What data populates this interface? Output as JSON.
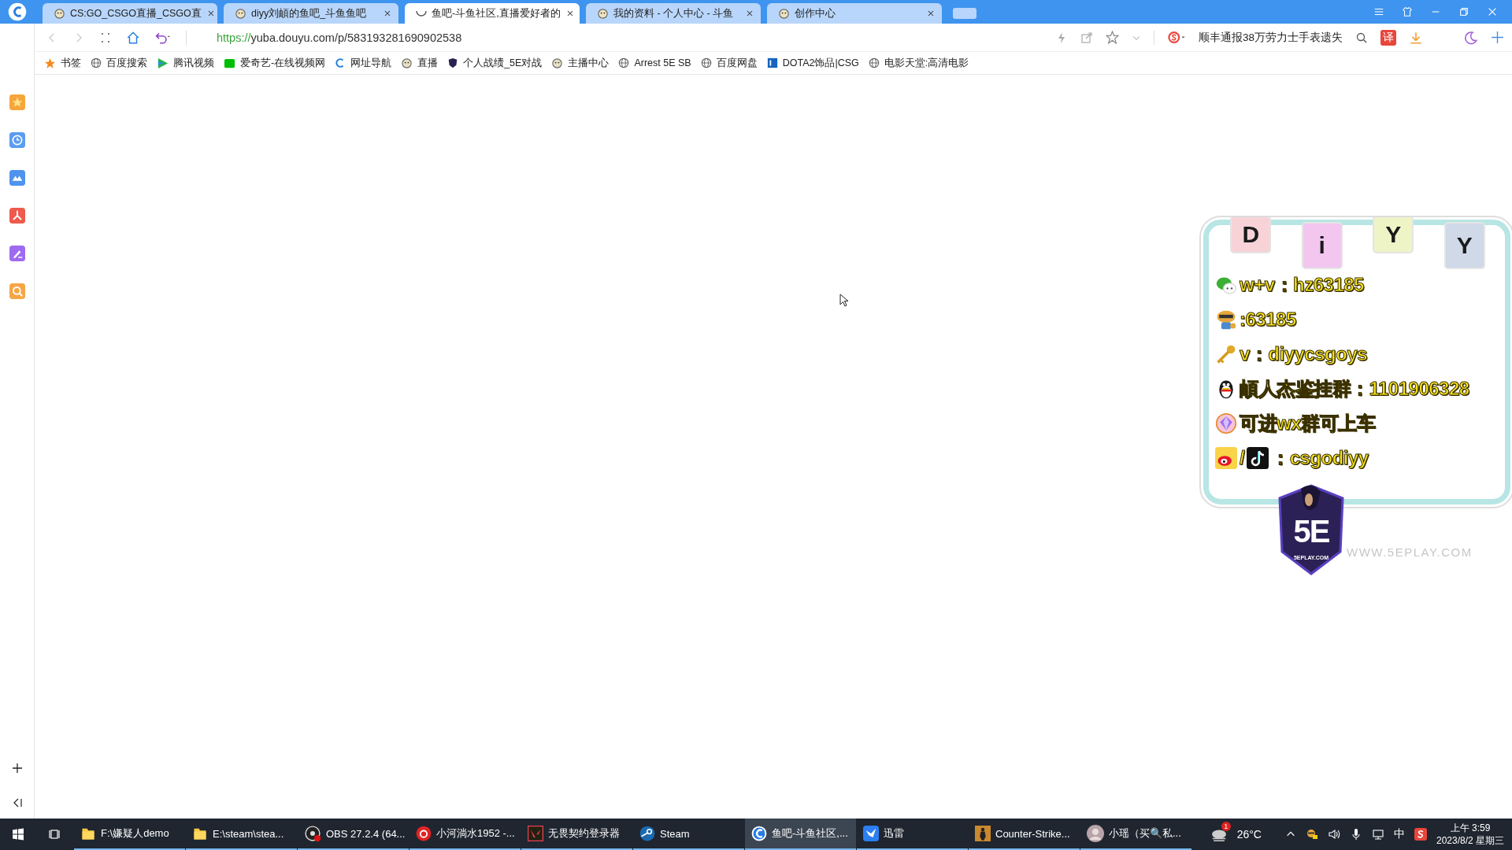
{
  "browser": {
    "tabs": [
      {
        "title": "CS:GO_CSGO直播_CSGO直",
        "selected": false,
        "loading": false
      },
      {
        "title": "diyy刘頔的鱼吧_斗鱼鱼吧",
        "selected": false,
        "loading": false
      },
      {
        "title": "鱼吧-斗鱼社区,直播爱好者的",
        "selected": true,
        "loading": true
      },
      {
        "title": "我的资料 - 个人中心 - 斗鱼",
        "selected": false,
        "loading": false
      },
      {
        "title": "创作中心",
        "selected": false,
        "loading": false
      }
    ],
    "address": {
      "scheme": "https://",
      "rest": "yuba.douyu.com/p/583193281690902538"
    },
    "search_hint": "顺丰通报38万劳力士手表遗失",
    "translate_label": "译",
    "bookmarks": [
      {
        "kind": "star",
        "label": "书签"
      },
      {
        "kind": "globe",
        "label": "百度搜索"
      },
      {
        "kind": "play",
        "label": "腾讯视频"
      },
      {
        "kind": "iqiyi",
        "label": "爱奇艺-在线视频网"
      },
      {
        "kind": "sogou",
        "label": "网址导航"
      },
      {
        "kind": "mascot",
        "label": "直播"
      },
      {
        "kind": "shield",
        "label": "个人战绩_5E对战"
      },
      {
        "kind": "mascot",
        "label": "主播中心"
      },
      {
        "kind": "globe",
        "label": "Arrest 5E SB"
      },
      {
        "kind": "globe",
        "label": "百度网盘"
      },
      {
        "kind": "ig",
        "label": "DOTA2饰品|CSG"
      },
      {
        "kind": "globe",
        "label": "电影天堂:高清电影"
      }
    ]
  },
  "overlay": {
    "letters": [
      {
        "text": "D",
        "color": "#f7d3d8"
      },
      {
        "text": "i",
        "color": "#f3c6f0"
      },
      {
        "text": "Y",
        "color": "#eef4c6"
      },
      {
        "text": "Y",
        "color": "#cfd9e8"
      }
    ],
    "lines": [
      {
        "kind": "wechat",
        "text": "w+v：hz63185"
      },
      {
        "kind": "mascot",
        "text": ":63185"
      },
      {
        "kind": "key",
        "text": "v：diyycsgoys"
      },
      {
        "kind": "penguin",
        "text": "頔人杰鉴挂群：1101906328"
      },
      {
        "kind": "gem",
        "text": "可进wx群可上车"
      },
      {
        "kind": "weibo",
        "prefix": "/",
        "text": "：csgodiyy"
      }
    ],
    "logo_text": "5E",
    "logo_caption": "5EPLAY.COM",
    "watermark": "WWW.5EPLAY.COM"
  },
  "taskbar": {
    "items": [
      {
        "kind": "folder",
        "label": "F:\\嫌疑人demo",
        "selected": false
      },
      {
        "kind": "folder",
        "label": "E:\\steam\\stea...",
        "selected": false
      },
      {
        "kind": "obs",
        "label": "OBS 27.2.4 (64...",
        "selected": false
      },
      {
        "kind": "netease",
        "label": "小河淌水1952 -...",
        "selected": false
      },
      {
        "kind": "valorant",
        "label": "无畏契约登录器",
        "selected": false
      },
      {
        "kind": "steam",
        "label": "Steam",
        "selected": false
      },
      {
        "kind": "browser",
        "label": "鱼吧-斗鱼社区,...",
        "selected": true
      },
      {
        "kind": "thunder",
        "label": "迅雷",
        "selected": false
      },
      {
        "kind": "cs",
        "label": "Counter-Strike...",
        "selected": false
      },
      {
        "kind": "avatar",
        "label": "小瑶（买🔍私...",
        "selected": false
      }
    ],
    "weather_badge": "1",
    "temperature": "26°C",
    "ime": "中",
    "time": "上午 3:59",
    "date": "2023/8/2 星期三"
  }
}
